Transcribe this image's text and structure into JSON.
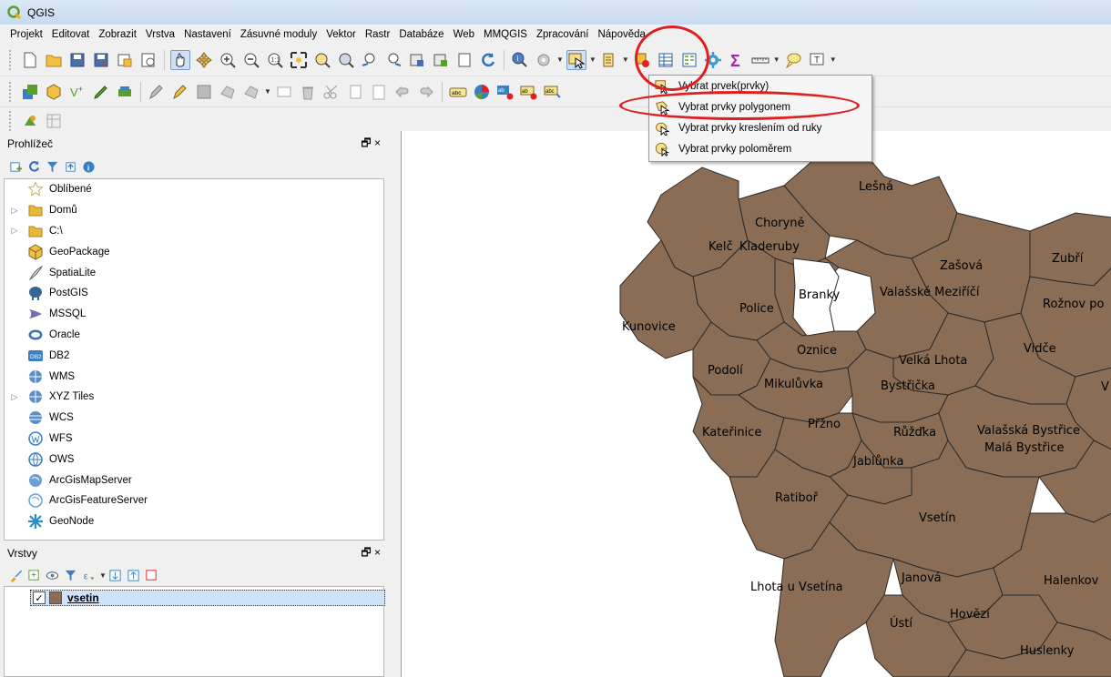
{
  "app": {
    "title": "QGIS",
    "accent": "#5a9e2d"
  },
  "menu": [
    "Projekt",
    "Editovat",
    "Zobrazit",
    "Vrstva",
    "Nastavení",
    "Zásuvné moduly",
    "Vektor",
    "Rastr",
    "Databáze",
    "Web",
    "MMQGIS",
    "Zpracování",
    "Nápověda"
  ],
  "browser": {
    "title": "Prohlížeč",
    "controls": "🗗 ×",
    "items": [
      {
        "label": "Oblíbené",
        "icon": "star-icon",
        "expandable": false
      },
      {
        "label": "Domů",
        "icon": "folder-icon",
        "expandable": true
      },
      {
        "label": "C:\\",
        "icon": "folder-icon",
        "expandable": true
      },
      {
        "label": "GeoPackage",
        "icon": "geopackage-icon",
        "expandable": false
      },
      {
        "label": "SpatiaLite",
        "icon": "spatialite-icon",
        "expandable": false
      },
      {
        "label": "PostGIS",
        "icon": "postgis-icon",
        "expandable": false
      },
      {
        "label": "MSSQL",
        "icon": "mssql-icon",
        "expandable": false
      },
      {
        "label": "Oracle",
        "icon": "oracle-icon",
        "expandable": false
      },
      {
        "label": "DB2",
        "icon": "db2-icon",
        "expandable": false
      },
      {
        "label": "WMS",
        "icon": "wms-icon",
        "expandable": false
      },
      {
        "label": "XYZ Tiles",
        "icon": "xyz-tiles-icon",
        "expandable": true
      },
      {
        "label": "WCS",
        "icon": "wcs-icon",
        "expandable": false
      },
      {
        "label": "WFS",
        "icon": "wfs-icon",
        "expandable": false
      },
      {
        "label": "OWS",
        "icon": "ows-icon",
        "expandable": false
      },
      {
        "label": "ArcGisMapServer",
        "icon": "arcgis-mapserver-icon",
        "expandable": false
      },
      {
        "label": "ArcGisFeatureServer",
        "icon": "arcgis-featureserver-icon",
        "expandable": false
      },
      {
        "label": "GeoNode",
        "icon": "geonode-icon",
        "expandable": false
      }
    ]
  },
  "layers": {
    "title": "Vrstvy",
    "controls": "🗗 ×",
    "items": [
      {
        "name": "vsetin",
        "checked": true,
        "check_glyph": "✓",
        "color": "#8b6d55"
      }
    ]
  },
  "selection_menu": {
    "items": [
      {
        "label": "Vybrat prvek(prvky)"
      },
      {
        "label": "Vybrat prvky polygonem"
      },
      {
        "label": "Vybrat prvky kreslením od ruky"
      },
      {
        "label": "Vybrat prvky poloměrem"
      }
    ]
  },
  "map": {
    "fill_color": "#8b6d55",
    "labels": [
      "Lešná",
      "Choryně",
      "Kelč",
      "Kladeruby",
      "Zašová",
      "Zubří",
      "Branky",
      "Valašské Meziříčí",
      "Rožnov po",
      "Police",
      "Kunovice",
      "Oznice",
      "Vidče",
      "Velká Lhota",
      "Podolí",
      "Mikulůvka",
      "Bystřička",
      "V",
      "Přžno",
      "Kateřinice",
      "Růžďka",
      "Valašská Bystřice",
      "Malá Bystřice",
      "Jablůnka",
      "Ratiboř",
      "Vsetín",
      "Lhota u Vsetína",
      "Janová",
      "Halenkov",
      "Hovězí",
      "Ústí",
      "Huslenky"
    ]
  }
}
